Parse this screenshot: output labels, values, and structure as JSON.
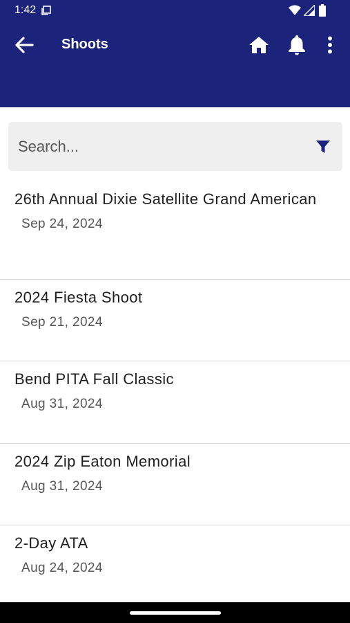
{
  "status_bar": {
    "time": "1:42"
  },
  "app_bar": {
    "title": "Shoots",
    "background_color": "#1b237a"
  },
  "search": {
    "placeholder": "Search...",
    "value": ""
  },
  "shoots": [
    {
      "title": "26th Annual Dixie Satellite Grand American",
      "date": "Sep 24, 2024"
    },
    {
      "title": "2024 Fiesta Shoot",
      "date": "Sep 21, 2024"
    },
    {
      "title": "Bend PITA Fall Classic",
      "date": "Aug 31, 2024"
    },
    {
      "title": "2024 Zip Eaton Memorial",
      "date": "Aug 31, 2024"
    },
    {
      "title": "2-Day ATA",
      "date": "Aug 24, 2024"
    }
  ],
  "icons": [
    "screen-icon",
    "wifi-icon",
    "signal-icon",
    "battery-icon",
    "back-arrow-icon",
    "home-icon",
    "bell-icon",
    "more-vert-icon",
    "filter-icon"
  ]
}
